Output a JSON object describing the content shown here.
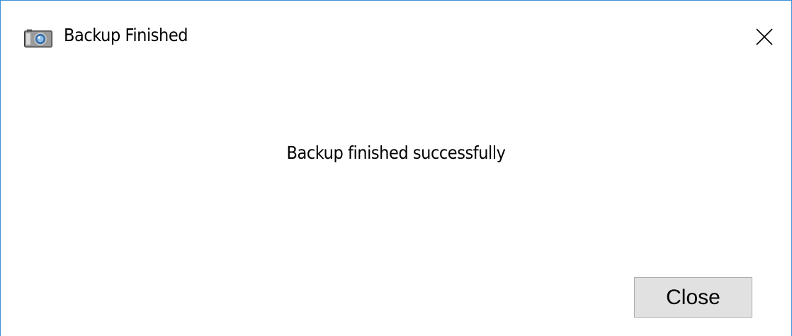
{
  "window": {
    "title": "Backup Finished",
    "icon": "camera-icon",
    "close_icon": "close-icon",
    "accent_border_color": "#3c8fd6"
  },
  "dialog": {
    "message": "Backup finished successfully",
    "close_button_label": "Close"
  }
}
